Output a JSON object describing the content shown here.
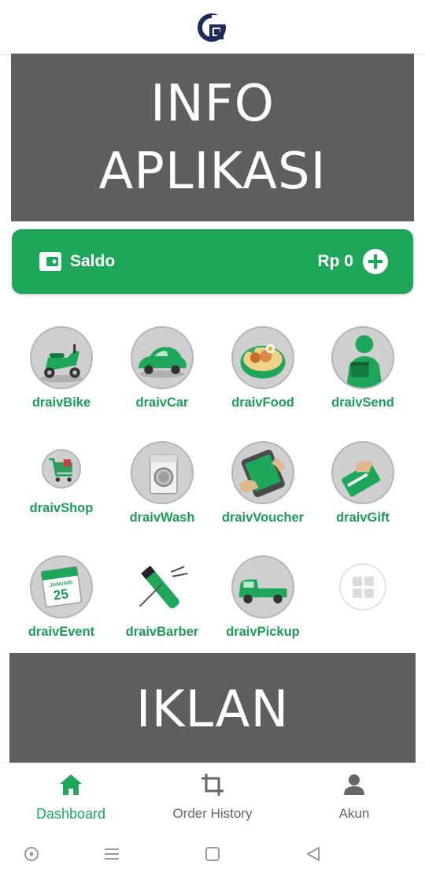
{
  "banners": {
    "info_line1": "INFO",
    "info_line2": "APLIKASI",
    "ads": "IKLAN"
  },
  "saldo": {
    "label": "Saldo",
    "amount": "Rp 0"
  },
  "services": [
    {
      "label": "draivBike",
      "icon": "scooter-icon"
    },
    {
      "label": "draivCar",
      "icon": "car-icon"
    },
    {
      "label": "draivFood",
      "icon": "food-bowl-icon"
    },
    {
      "label": "draivSend",
      "icon": "courier-icon"
    },
    {
      "label": "draivShop",
      "icon": "shopping-cart-icon"
    },
    {
      "label": "draivWash",
      "icon": "washing-machine-icon"
    },
    {
      "label": "draivVoucher",
      "icon": "voucher-phone-icon"
    },
    {
      "label": "draivGift",
      "icon": "gift-card-icon"
    },
    {
      "label": "draivEvent",
      "icon": "calendar-icon"
    },
    {
      "label": "draivBarber",
      "icon": "hair-clipper-icon"
    },
    {
      "label": "draivPickup",
      "icon": "pickup-truck-icon"
    }
  ],
  "calendar": {
    "month": "JANUARI",
    "day": "25"
  },
  "bottom_nav": [
    {
      "label": "Dashboard",
      "icon": "home-icon",
      "active": true
    },
    {
      "label": "Order History",
      "icon": "crop-icon",
      "active": false
    },
    {
      "label": "Akun",
      "icon": "person-icon",
      "active": false
    }
  ],
  "colors": {
    "brand_green": "#1ea65a",
    "banner_gray": "#5e5e5e",
    "logo_navy": "#1f2a5c"
  }
}
